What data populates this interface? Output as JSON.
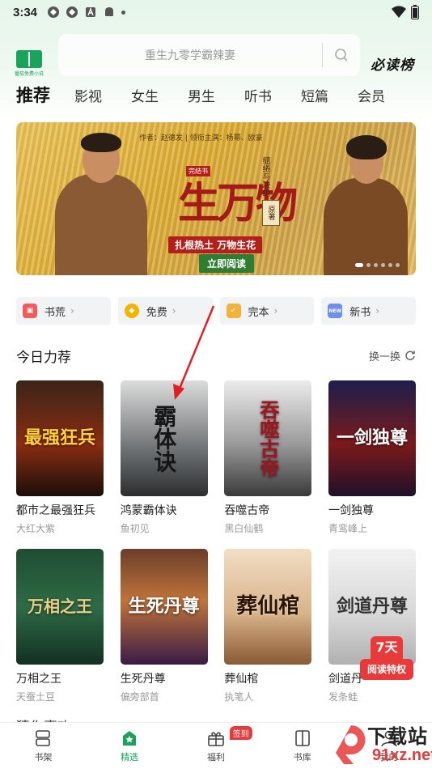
{
  "status_bar": {
    "time": "3:34"
  },
  "header": {
    "logo_caption": "番茄免费小说",
    "search_placeholder": "重生九零学霸辣妻",
    "must_read": "必读榜"
  },
  "tabs": [
    "推荐",
    "影视",
    "女生",
    "男生",
    "听书",
    "短篇",
    "会员"
  ],
  "banner": {
    "credit": "作者：赵德发 | 领衔主演：杨幂、欧豪",
    "badge": "完结书",
    "title": "生万物",
    "subtitle": "缱绻与决绝",
    "origin": "原著",
    "slogan": "扎根热土 万物生花",
    "cta": "立即阅读"
  },
  "categories": [
    {
      "label": "书荒",
      "icon": "gift-icon",
      "color": "#f25b5b"
    },
    {
      "label": "免费",
      "icon": "coin-icon",
      "color": "#f5b400"
    },
    {
      "label": "完本",
      "icon": "shield-check-icon",
      "color": "#f0b43c"
    },
    {
      "label": "新书",
      "icon": "new-book-icon",
      "color": "#6e8ff0"
    }
  ],
  "section": {
    "title": "今日力荐",
    "refresh": "换一换"
  },
  "books_row1": [
    {
      "title": "都市之最强狂兵",
      "author": "大红大紫",
      "cover_text": "最强狂兵",
      "cover_bg": "linear-gradient(180deg,#3a2418,#8a2d12 55%,#1b0e08)",
      "cover_color": "#ffcf3a"
    },
    {
      "title": "鸿蒙霸体诀",
      "author": "鱼初见",
      "cover_text": "霸体诀",
      "cover_bg": "linear-gradient(180deg,#dcdcdc,#6e7173 60%,#2b2d2f)",
      "cover_color": "#161616"
    },
    {
      "title": "吞噬古帝",
      "author": "黑白仙鹤",
      "cover_text": "吞噬古帝",
      "cover_bg": "linear-gradient(180deg,#ececec,#9a9a9a 55%,#3a3a3a)",
      "cover_color": "#a0141a"
    },
    {
      "title": "一剑独尊",
      "author": "青鸾峰上",
      "cover_text": "一剑独尊",
      "cover_bg": "linear-gradient(180deg,#1b1f4d,#7a1a1a 55%,#20102a)",
      "cover_color": "#ffffff"
    }
  ],
  "books_row2": [
    {
      "title": "万相之王",
      "author": "天蚕土豆",
      "cover_text": "万相之王",
      "cover_bg": "linear-gradient(180deg,#1f4d33,#2e6b45 50%,#123022)",
      "cover_color": "#e8d088"
    },
    {
      "title": "生死丹尊",
      "author": "偏旁部首",
      "cover_text": "生死丹尊",
      "cover_bg": "linear-gradient(180deg,#6b3e2a,#c0743a 45%,#3a1b45)",
      "cover_color": "#ffffff"
    },
    {
      "title": "葬仙棺",
      "author": "执笔人",
      "cover_text": "葬仙棺",
      "cover_bg": "linear-gradient(180deg,#f2ddc4,#d9b48a 55%,#8a5a34)",
      "cover_color": "#2a1406"
    },
    {
      "title": "剑道丹",
      "author": "发条蛙",
      "cover_text": "剑道丹尊",
      "cover_bg": "linear-gradient(180deg,#f2f2f2,#d6d6d6 60%,#b0b0b0)",
      "cover_color": "#333333"
    }
  ],
  "promo": {
    "days": "7天",
    "label": "阅读特权"
  },
  "next_section_peek": "猜你喜欢",
  "bottom_tabs": [
    {
      "label": "书架",
      "icon": "bookshelf-icon",
      "active": false
    },
    {
      "label": "精选",
      "icon": "star-home-icon",
      "active": true
    },
    {
      "label": "福利",
      "icon": "gift-box-icon",
      "active": false,
      "badge": "签到"
    },
    {
      "label": "书库",
      "icon": "library-icon",
      "active": false
    },
    {
      "label": "我的",
      "icon": "profile-icon",
      "active": false
    }
  ],
  "watermark": {
    "line1": "下载站",
    "line2": "91xz.net"
  },
  "colors": {
    "brand_green": "#1aa35b",
    "accent_red": "#e83a3a"
  }
}
